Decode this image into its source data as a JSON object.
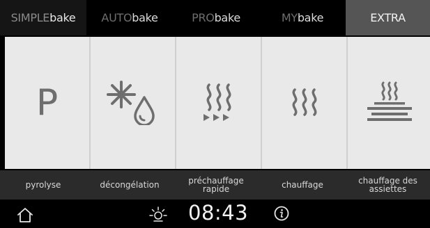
{
  "tabs": [
    {
      "prefix": "SIMPLE",
      "suffix": "bake"
    },
    {
      "prefix": "AUTO",
      "suffix": "bake"
    },
    {
      "prefix": "PRO",
      "suffix": "bake"
    },
    {
      "prefix": "MY",
      "suffix": "bake"
    },
    {
      "prefix": "",
      "suffix": "EXTRA"
    }
  ],
  "active_tab": "EXTRA",
  "tiles": [
    {
      "icon": "pyrolysis-p-icon",
      "letter": "P",
      "label_lines": [
        "pyrolyse"
      ]
    },
    {
      "icon": "defrost-icon",
      "label_lines": [
        "décongélation"
      ]
    },
    {
      "icon": "rapid-preheat-icon",
      "label_lines": [
        "préchauffage",
        "rapide"
      ]
    },
    {
      "icon": "heating-icon",
      "label_lines": [
        "chauffage"
      ]
    },
    {
      "icon": "plate-warming-icon",
      "label_lines": [
        "chauffage des",
        "assiettes"
      ]
    }
  ],
  "bottom": {
    "time": "08:43",
    "home_icon": "home-icon",
    "light_icon": "oven-light-icon",
    "info_icon": "info-icon"
  },
  "colors": {
    "tile_bg": "#e9e9e9",
    "icon_gray": "#6e6e6e",
    "active_tab_bg": "#555555",
    "label_bar_bg": "#2b2b2b"
  }
}
